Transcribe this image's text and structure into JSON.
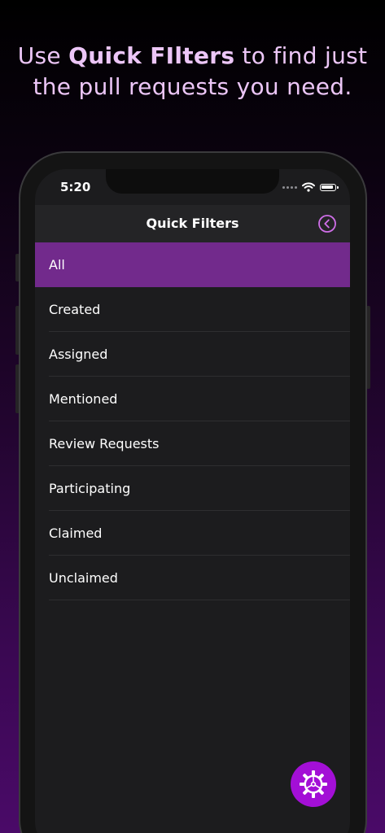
{
  "headline": {
    "line1_pre": "Use ",
    "line1_bold": "Quick FIlters",
    "line1_post": " to find just",
    "line2": "the pull requests you need."
  },
  "status_bar": {
    "time": "5:20",
    "icons": [
      "signal-dots-icon",
      "wifi-icon",
      "battery-icon"
    ]
  },
  "navbar": {
    "title": "Quick Filters",
    "back_icon": "circle-chevron-left-icon"
  },
  "filters": [
    {
      "label": "All",
      "selected": true
    },
    {
      "label": "Created",
      "selected": false
    },
    {
      "label": "Assigned",
      "selected": false
    },
    {
      "label": "Mentioned",
      "selected": false
    },
    {
      "label": "Review Requests",
      "selected": false
    },
    {
      "label": "Participating",
      "selected": false
    },
    {
      "label": "Claimed",
      "selected": false
    },
    {
      "label": "Unclaimed",
      "selected": false
    }
  ],
  "fab": {
    "icon": "settings-gear-icon"
  },
  "colors": {
    "accent": "#722a8c",
    "fab": "#a30fd6",
    "headline_text": "#ecc6f7",
    "nav_icon": "#cf6ee8"
  }
}
